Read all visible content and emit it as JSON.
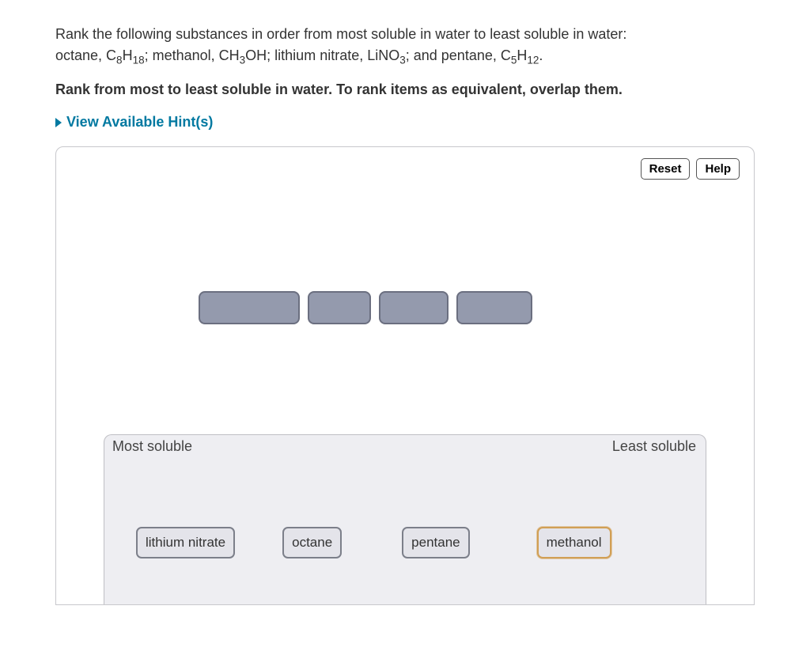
{
  "question": {
    "line1_prefix": "Rank the following substances in order from most soluble in water to least soluble in water:",
    "line2_parts": {
      "p1": "octane, ",
      "f1a": "C",
      "f1s1": "8",
      "f1b": "H",
      "f1s2": "18",
      "p2": "; methanol, ",
      "f2a": "CH",
      "f2s1": "3",
      "f2b": "OH",
      "p3": "; lithium nitrate, ",
      "f3a": "LiNO",
      "f3s1": "3",
      "p4": "; and pentane, ",
      "f4a": "C",
      "f4s1": "5",
      "f4b": "H",
      "f4s2": "12",
      "p5": "."
    }
  },
  "instruction": "Rank from most to least soluble in water. To rank items as equivalent, overlap them.",
  "hints_label": "View Available Hint(s)",
  "toolbar": {
    "reset": "Reset",
    "help": "Help"
  },
  "zone": {
    "left_label": "Most soluble",
    "right_label": "Least soluble"
  },
  "chips": {
    "lithium_nitrate": "lithium nitrate",
    "octane": "octane",
    "pentane": "pentane",
    "methanol": "methanol"
  }
}
